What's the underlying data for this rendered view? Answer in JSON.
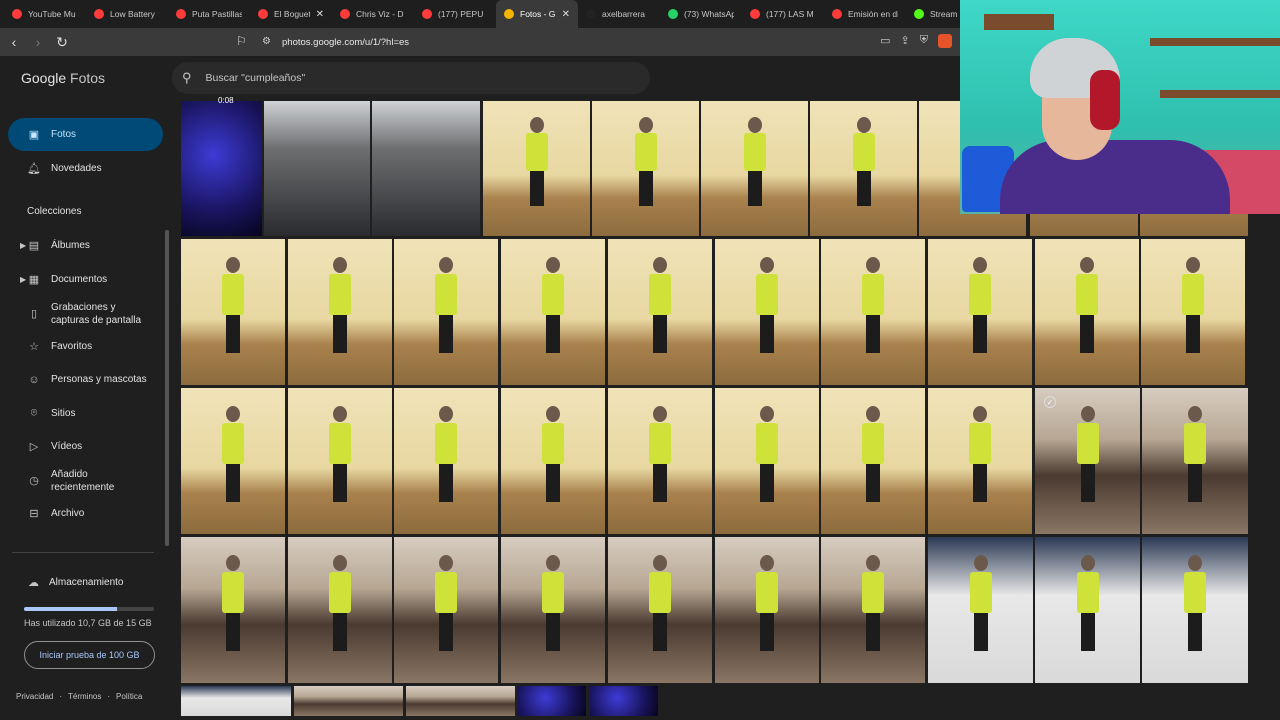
{
  "browser": {
    "tabs": [
      {
        "label": "YouTube Mu",
        "color": "#ff3b3b",
        "active": false
      },
      {
        "label": "Low Battery",
        "color": "#ff3b3b",
        "active": false
      },
      {
        "label": "Puta Pastillas",
        "color": "#ff3b3b",
        "active": false
      },
      {
        "label": "El Bogueto",
        "color": "#ff3b3b",
        "active": false,
        "close": "✕"
      },
      {
        "label": "Chris Viz - D",
        "color": "#ff3b3b",
        "active": false
      },
      {
        "label": "(177) PEPU",
        "color": "#ff3b3b",
        "active": false
      },
      {
        "label": "Fotos - G",
        "color": "#f4b400",
        "active": true,
        "close": "✕"
      },
      {
        "label": "axelbarrera",
        "color": "#222222",
        "active": false
      },
      {
        "label": "(73) WhatsAp",
        "color": "#25d366",
        "active": false
      },
      {
        "label": "(177) LAS M",
        "color": "#ff3b3b",
        "active": false
      },
      {
        "label": "Emisión en di",
        "color": "#ff3b3b",
        "active": false
      },
      {
        "label": "Stream",
        "color": "#53fc18",
        "active": false
      }
    ],
    "url": "photos.google.com/u/1/?hl=es"
  },
  "app": {
    "logo_google": "Google",
    "logo_fotos": "Fotos",
    "search_placeholder": "Buscar \"cumpleaños\""
  },
  "sidebar": {
    "items": [
      {
        "label": "Fotos",
        "icon": "photo-icon",
        "active": true
      },
      {
        "label": "Novedades",
        "icon": "bell-icon"
      }
    ],
    "section": "Colecciones",
    "collections": [
      {
        "label": "Álbumes",
        "icon": "album-icon",
        "expandable": true
      },
      {
        "label": "Documentos",
        "icon": "document-icon",
        "expandable": true
      },
      {
        "label": "Grabaciones y capturas de pantalla",
        "icon": "screenshot-icon"
      },
      {
        "label": "Favoritos",
        "icon": "star-icon"
      },
      {
        "label": "Personas y mascotas",
        "icon": "face-icon"
      },
      {
        "label": "Sitios",
        "icon": "pin-icon"
      },
      {
        "label": "Vídeos",
        "icon": "play-icon"
      },
      {
        "label": "Añadido recientemente",
        "icon": "recent-icon"
      },
      {
        "label": "Archivo",
        "icon": "archive-icon"
      }
    ],
    "storage": {
      "label": "Almacenamiento",
      "used_text": "Has utilizado 10,7 GB de 15 GB",
      "used_fraction": 0.713,
      "trial_button": "Iniciar prueba de 100 GB"
    },
    "footer": [
      "Privacidad",
      "·",
      "Términos",
      "·",
      "Política"
    ]
  },
  "grid": {
    "video_duration": "0:08"
  }
}
